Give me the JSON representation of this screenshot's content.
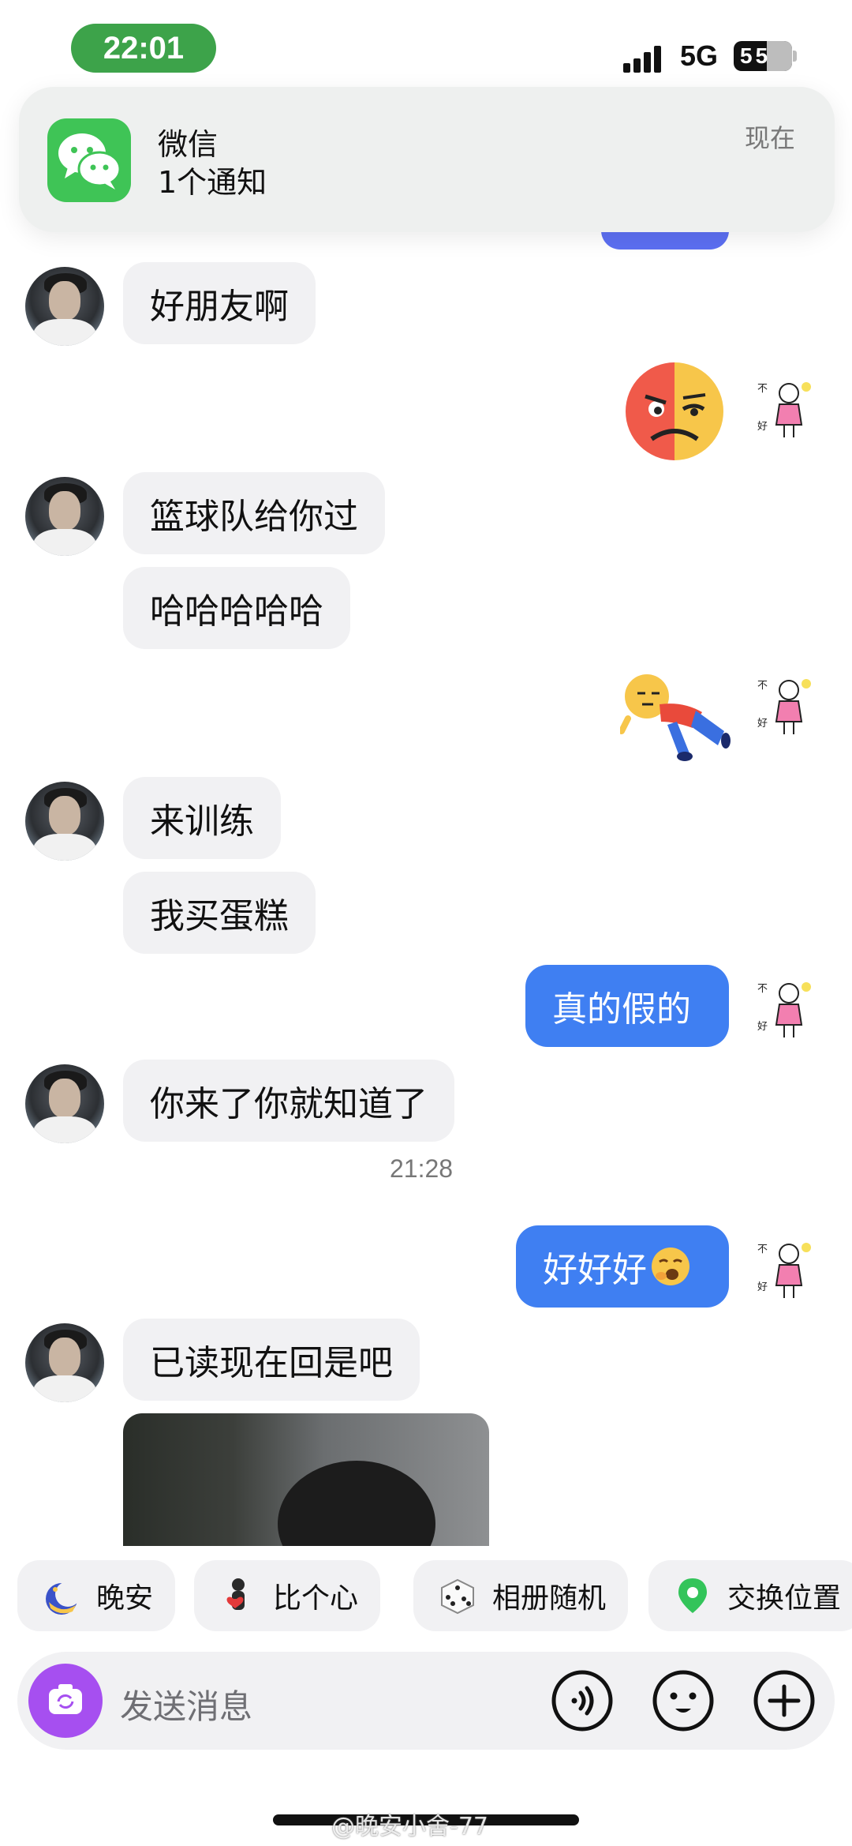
{
  "status_bar": {
    "time": "22:01",
    "network": "5G",
    "battery": "55"
  },
  "notification": {
    "app": "微信",
    "message": "1个通知",
    "time": "现在"
  },
  "messages": {
    "m1": "好朋友啊",
    "m2": "篮球队给你过",
    "m3": "哈哈哈哈哈",
    "m4": "来训练",
    "m5": "我买蛋糕",
    "m6": "真的假的",
    "m7": "你来了你就知道了",
    "timestamp": "21:28",
    "m8": "好好好",
    "m9": "已读现在回是吧"
  },
  "quick_actions": [
    "晚安",
    "比个心",
    "相册随机",
    "交换位置"
  ],
  "input": {
    "placeholder": "发送消息"
  },
  "watermark": "@晚安小舍-77",
  "colors": {
    "outgoing_bubble": "#3f7ff2",
    "incoming_bubble": "#f1f1f3",
    "time_pill": "#3da34a",
    "camera_button": "#a64ff0"
  }
}
